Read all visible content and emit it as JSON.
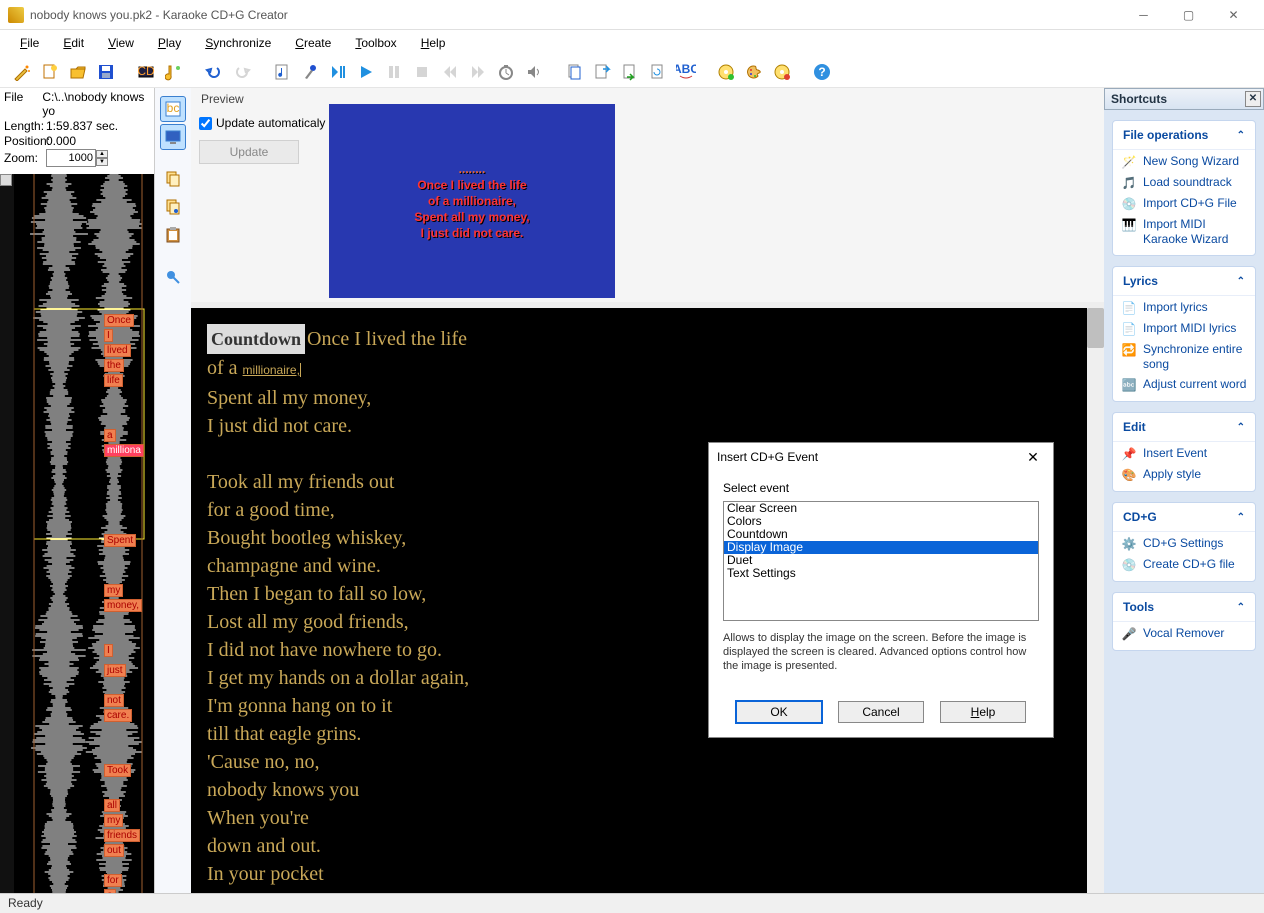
{
  "window": {
    "title": "nobody knows you.pk2 - Karaoke CD+G Creator"
  },
  "menu": [
    "File",
    "Edit",
    "View",
    "Play",
    "Synchronize",
    "Create",
    "Toolbox",
    "Help"
  ],
  "file_info": {
    "file_label": "File",
    "file_value": "C:\\..\\nobody knows yo",
    "length_label": "Length:",
    "length_value": "1:59.837 sec.",
    "position_label": "Position:",
    "position_value": "0.000",
    "zoom_label": "Zoom:",
    "zoom_value": "1000"
  },
  "preview": {
    "title": "Preview",
    "update_auto_label": "Update automaticaly",
    "update_auto_checked": true,
    "update_btn": "Update",
    "lines": [
      "........",
      "Once I lived the life",
      "of a millionaire,",
      "Spent all my money,",
      "I just did not care."
    ]
  },
  "lyrics": {
    "countdown_chip": "Countdown",
    "lines": [
      "Once I lived the life",
      "of a millionaire,",
      "Spent all my money,",
      "I just did not care.",
      "",
      "Took all my friends out",
      "for a good time,",
      "Bought bootleg whiskey,",
      "champagne and wine.",
      "Then I began to fall so low,",
      "Lost all my good friends,",
      "I did not have nowhere to go.",
      "I get my hands on a dollar again,",
      "I'm gonna hang on to it",
      "till that eagle grins.",
      "'Cause no, no,",
      "nobody knows you",
      "When you're",
      "down and out.",
      "In your pocket"
    ]
  },
  "wave_labels": [
    "Once",
    "I",
    "lived",
    "the",
    "life",
    "",
    "a",
    "milliona",
    "Spent",
    "",
    "my",
    "money,",
    "I",
    "just",
    "not",
    "care.",
    "Took",
    "all",
    "my",
    "friends",
    "out",
    "for",
    "a"
  ],
  "shortcuts": {
    "title": "Shortcuts",
    "groups": [
      {
        "title": "File operations",
        "items": [
          "New Song Wizard",
          "Load soundtrack",
          "Import CD+G File",
          "Import MIDI Karaoke Wizard"
        ]
      },
      {
        "title": "Lyrics",
        "items": [
          "Import lyrics",
          "Import MIDI lyrics",
          "Synchronize entire song",
          "Adjust current word"
        ]
      },
      {
        "title": "Edit",
        "items": [
          "Insert Event",
          "Apply style"
        ]
      },
      {
        "title": "CD+G",
        "items": [
          "CD+G Settings",
          "Create CD+G file"
        ]
      },
      {
        "title": "Tools",
        "items": [
          "Vocal Remover"
        ]
      }
    ]
  },
  "dialog": {
    "title": "Insert CD+G Event",
    "select_label": "Select event",
    "options": [
      "Clear Screen",
      "Colors",
      "Countdown",
      "Display Image",
      "Duet",
      "Text Settings"
    ],
    "selected": "Display Image",
    "description": "Allows to display the image on the screen. Before the image is displayed the screen is cleared. Advanced options control how the image is presented.",
    "ok": "OK",
    "cancel": "Cancel",
    "help": "Help"
  },
  "status": "Ready"
}
